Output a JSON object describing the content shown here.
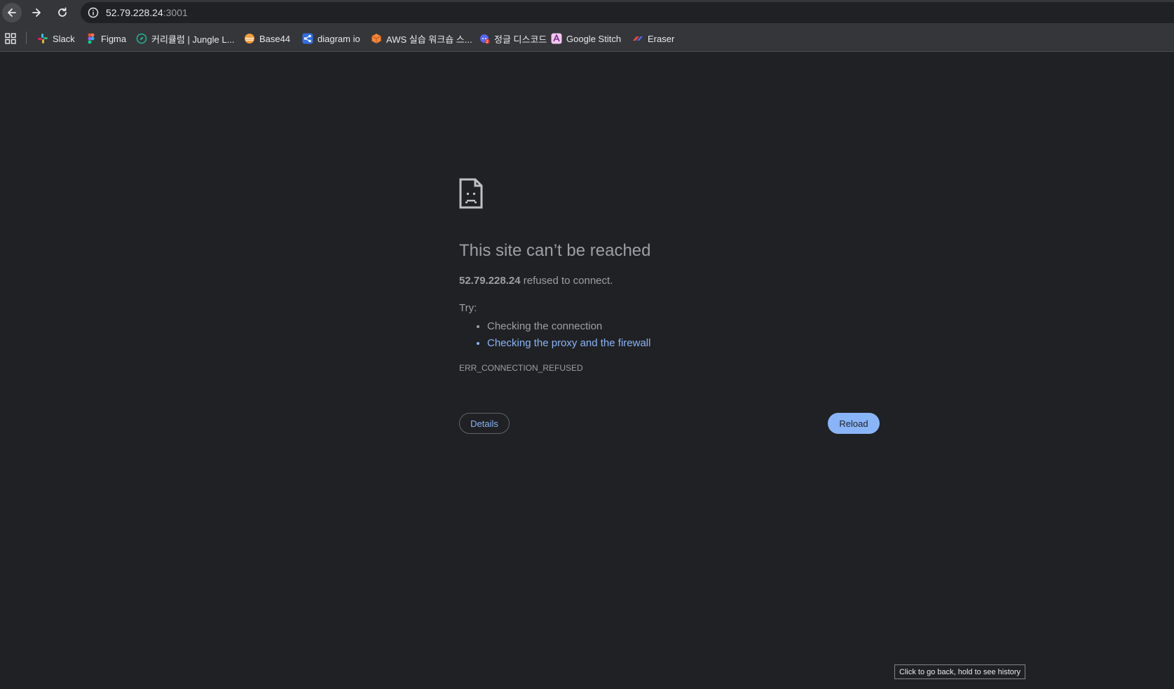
{
  "browser": {
    "address_bar": {
      "host": "52.79.228.24",
      "port_suffix": ":3001"
    },
    "bookmarks": [
      {
        "label": "Slack",
        "icon": "slack-icon"
      },
      {
        "label": "Figma",
        "icon": "figma-icon"
      },
      {
        "label": "커리큘럼 | Jungle L...",
        "icon": "compass-icon"
      },
      {
        "label": "Base44",
        "icon": "base44-icon"
      },
      {
        "label": "diagram io",
        "icon": "diagram-icon"
      },
      {
        "label": "AWS 실습 워크숍 스...",
        "icon": "aws-cube-icon"
      },
      {
        "label": "정글 디스코드",
        "icon": "discord-icon"
      },
      {
        "label": "Google Stitch",
        "icon": "stitch-icon"
      },
      {
        "label": "Eraser",
        "icon": "eraser-icon"
      }
    ],
    "tooltip": "Click to go back, hold to see history"
  },
  "error_page": {
    "title": "This site can’t be reached",
    "host": "52.79.228.24",
    "message_suffix": " refused to connect.",
    "try_label": "Try:",
    "suggestions": {
      "connection": "Checking the connection",
      "proxy_firewall": "Checking the proxy and the firewall"
    },
    "error_code": "ERR_CONNECTION_REFUSED",
    "details_label": "Details",
    "reload_label": "Reload"
  },
  "colors": {
    "background": "#202124",
    "toolbar": "#35363a",
    "text_muted": "#9aa0a6",
    "link": "#8ab4f8",
    "primary_button": "#8ab4f8"
  }
}
